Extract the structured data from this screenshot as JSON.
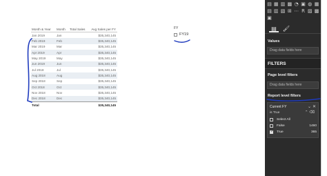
{
  "table": {
    "headers": [
      "Month & Year",
      "Month",
      "Total Sales",
      "Avg Sales per FY"
    ],
    "rows": [
      [
        "Jan 2019",
        "Jan",
        "",
        "$35,340,145"
      ],
      [
        "Feb 2019",
        "Feb",
        "",
        "$35,340,145"
      ],
      [
        "Mar 2019",
        "Mar",
        "",
        "$35,340,145"
      ],
      [
        "Apr 2019",
        "Apr",
        "",
        "$35,340,145"
      ],
      [
        "May 2019",
        "May",
        "",
        "$35,340,145"
      ],
      [
        "Jun 2019",
        "Jun",
        "",
        "$35,340,145"
      ],
      [
        "Jul 2018",
        "Jul",
        "",
        "$35,340,145"
      ],
      [
        "Aug 2018",
        "Aug",
        "",
        "$35,340,145"
      ],
      [
        "Sep 2018",
        "Sep",
        "",
        "$35,340,145"
      ],
      [
        "Oct 2018",
        "Oct",
        "",
        "$35,340,145"
      ],
      [
        "Nov 2018",
        "Nov",
        "",
        "$35,340,145"
      ],
      [
        "Dec 2018",
        "Dec",
        "",
        "$35,340,145"
      ]
    ],
    "total": [
      "Total",
      "",
      "",
      "$35,340,145"
    ]
  },
  "slicer": {
    "title": "FY",
    "item": "FY19"
  },
  "pane": {
    "viz_icons": [
      "▤",
      "▦",
      "▥",
      "▩",
      "◔",
      "▣",
      "◍",
      "▦",
      "▤",
      "▥",
      "▧",
      "⊞",
      "⋯",
      "R",
      "▨",
      "▩",
      "▣"
    ],
    "tabs": [
      "fields-tab-icon",
      "format-tab-icon"
    ],
    "values_label": "Values",
    "values_drop": "Drag data fields here",
    "filters_header": "FILTERS",
    "page_filters_label": "Page level filters",
    "page_filters_drop": "Drag data fields here",
    "report_filters_label": "Report level filters",
    "filter_card": {
      "title": "Current FY",
      "subtitle": "is True",
      "options": [
        {
          "label": "Select All",
          "count": "",
          "checked": false
        },
        {
          "label": "False",
          "count": "1460",
          "checked": false
        },
        {
          "label": "True",
          "count": "365",
          "checked": true
        }
      ]
    }
  },
  "colors": {
    "pane_bg": "#2b2b2b",
    "annotation": "#1f3bbd",
    "row_alt": "#e9eef3"
  }
}
